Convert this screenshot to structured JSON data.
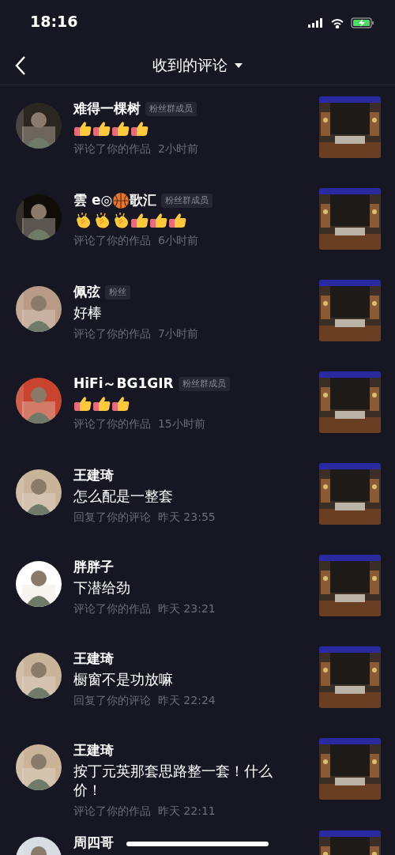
{
  "status_bar": {
    "time": "18:16"
  },
  "header": {
    "title": "收到的评论"
  },
  "items": [
    {
      "name": [
        {
          "kind": "text",
          "text": "难得一棵树"
        }
      ],
      "badge": "粉丝群成员",
      "comment": [
        {
          "kind": "thumbs_up"
        },
        {
          "kind": "thumbs_up"
        },
        {
          "kind": "thumbs_up"
        },
        {
          "kind": "thumbs_up"
        }
      ],
      "action": "评论了你的作品",
      "time": "2小时前"
    },
    {
      "name": [
        {
          "kind": "text",
          "text": "雲 e◎"
        },
        {
          "kind": "basketball"
        },
        {
          "kind": "text",
          "text": "歌汇"
        }
      ],
      "badge": "粉丝群成员",
      "comment": [
        {
          "kind": "clap"
        },
        {
          "kind": "clap"
        },
        {
          "kind": "clap"
        },
        {
          "kind": "thumbs_up"
        },
        {
          "kind": "thumbs_up"
        },
        {
          "kind": "thumbs_up"
        }
      ],
      "action": "评论了你的作品",
      "time": "6小时前"
    },
    {
      "name": [
        {
          "kind": "text",
          "text": "佩弦"
        }
      ],
      "badge": "粉丝",
      "comment": [
        {
          "kind": "text",
          "text": "好棒"
        }
      ],
      "action": "评论了你的作品",
      "time": "7小时前"
    },
    {
      "name": [
        {
          "kind": "text",
          "text": "HiFi～BG1GIR"
        }
      ],
      "badge": "粉丝群成员",
      "comment": [
        {
          "kind": "thumbs_up"
        },
        {
          "kind": "thumbs_up"
        },
        {
          "kind": "thumbs_up"
        }
      ],
      "action": "评论了你的作品",
      "time": "15小时前"
    },
    {
      "name": [
        {
          "kind": "text",
          "text": "王建琦"
        }
      ],
      "comment": [
        {
          "kind": "text",
          "text": "怎么配是一整套"
        }
      ],
      "action": "回复了你的评论",
      "time": "昨天 23:55"
    },
    {
      "name": [
        {
          "kind": "text",
          "text": "胖胖子"
        }
      ],
      "comment": [
        {
          "kind": "text",
          "text": "下潜给劲"
        }
      ],
      "action": "评论了你的作品",
      "time": "昨天 23:21"
    },
    {
      "name": [
        {
          "kind": "text",
          "text": "王建琦"
        }
      ],
      "comment": [
        {
          "kind": "text",
          "text": "橱窗不是功放嘛"
        }
      ],
      "action": "回复了你的评论",
      "time": "昨天 22:24"
    },
    {
      "name": [
        {
          "kind": "text",
          "text": "王建琦"
        }
      ],
      "comment": [
        {
          "kind": "text",
          "text": "按丁元英那套思路整一套！什么价！"
        }
      ],
      "action": "评论了你的作品",
      "time": "昨天 22:11"
    },
    {
      "name": [
        {
          "kind": "text",
          "text": "周四哥"
        }
      ]
    }
  ]
}
